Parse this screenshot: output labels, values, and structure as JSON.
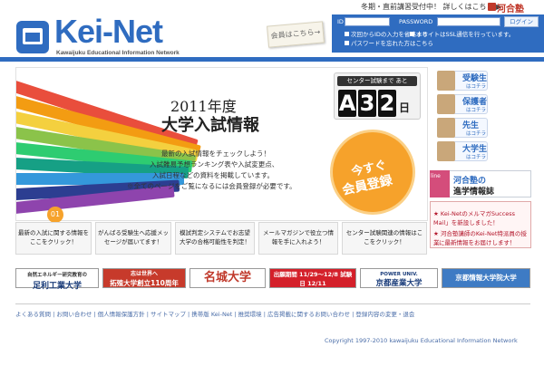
{
  "header": {
    "winter_notice": "冬期・直前講習受付中！ 詳しくはこちら ▶",
    "kawai_label": "河合塾",
    "logo_text": "Kei-Net",
    "logo_sub": "Kawaijuku Educational Information Network",
    "member_note": "会員はこちら→"
  },
  "login": {
    "id_label": "ID",
    "password_label": "PASSWORD",
    "login_button": "ログイン",
    "option_remember": "次回からIDの入力を省略する",
    "option_ssl": "本サイトはSSL通信を行っています。",
    "option_forgot": "パスワードを忘れた方はこちら"
  },
  "hero": {
    "title_year": "2011年度",
    "title_main": "大学入試情報",
    "desc": [
      "最新の入試情報をチェックしよう！",
      "入試難易予想ランキング表や入試変更点、",
      "入試日程などの資料を掲載しています。",
      "※全てのページをご覧になるには会員登録が必要です。"
    ],
    "countdown_label": "センター試験まで あと",
    "countdown_digits": [
      "3",
      "2"
    ],
    "countdown_prefix": "A",
    "countdown_unit": "日",
    "register_line1": "今すぐ",
    "register_line2": "会員登録"
  },
  "side_menu": [
    {
      "label": "受験生",
      "sub": "はコチラ"
    },
    {
      "label": "保護者",
      "sub": "はコチラ"
    },
    {
      "label": "先生",
      "sub": "はコチラ"
    },
    {
      "label": "大学生",
      "sub": "はコチラ"
    }
  ],
  "kawai_box": {
    "online": "line",
    "title1": "河合塾の",
    "title2": "進学情報誌"
  },
  "news": [
    "★ Kei-NetのメルマガSuccess Mail」を新設しました！",
    "★ 河合塾講師のKei-Net特派員の授業",
    "に最新情報をお届けします！"
  ],
  "promos": {
    "badge": "01",
    "items": [
      "最新の入試に関する情報をここをクリック！",
      "がんばる受験生へ応援メッセージが届いてます！",
      "模試判定システムでお志望大学の合格可能性を判定！",
      "メールマガジンで役立つ情報を手に入れよう！",
      "センター試験関連の情報はここをクリック！"
    ]
  },
  "banners": [
    {
      "text": "足利工業大学",
      "sub": "自然エネルギー研究教育の"
    },
    {
      "text": "拓殖大学創立110周年",
      "sub": "志は世界へ"
    },
    {
      "text": "名城大学",
      "sub": ""
    },
    {
      "text": "出願期間 11/29～12/8 試験日 12/11",
      "sub": ""
    },
    {
      "text": "京都産業大学",
      "sub": "POWER UNIV."
    },
    {
      "text": "京都情報大学院大学",
      "sub": ""
    }
  ],
  "footer": {
    "links": "よくある質問 | お問い合わせ | 個人情報保護方針 | サイトマップ | 携帯版 Kei-Net | 推奨環境 | 広告掲載に関するお問い合わせ | 登録内容の変更・退会",
    "copyright": "Copyright 1997-2010 kawaijuku Educational Information Network"
  },
  "colors": {
    "brand_blue": "#2f6cc0",
    "accent_orange": "#f6a22b",
    "kawai_red": "#c0392b"
  }
}
